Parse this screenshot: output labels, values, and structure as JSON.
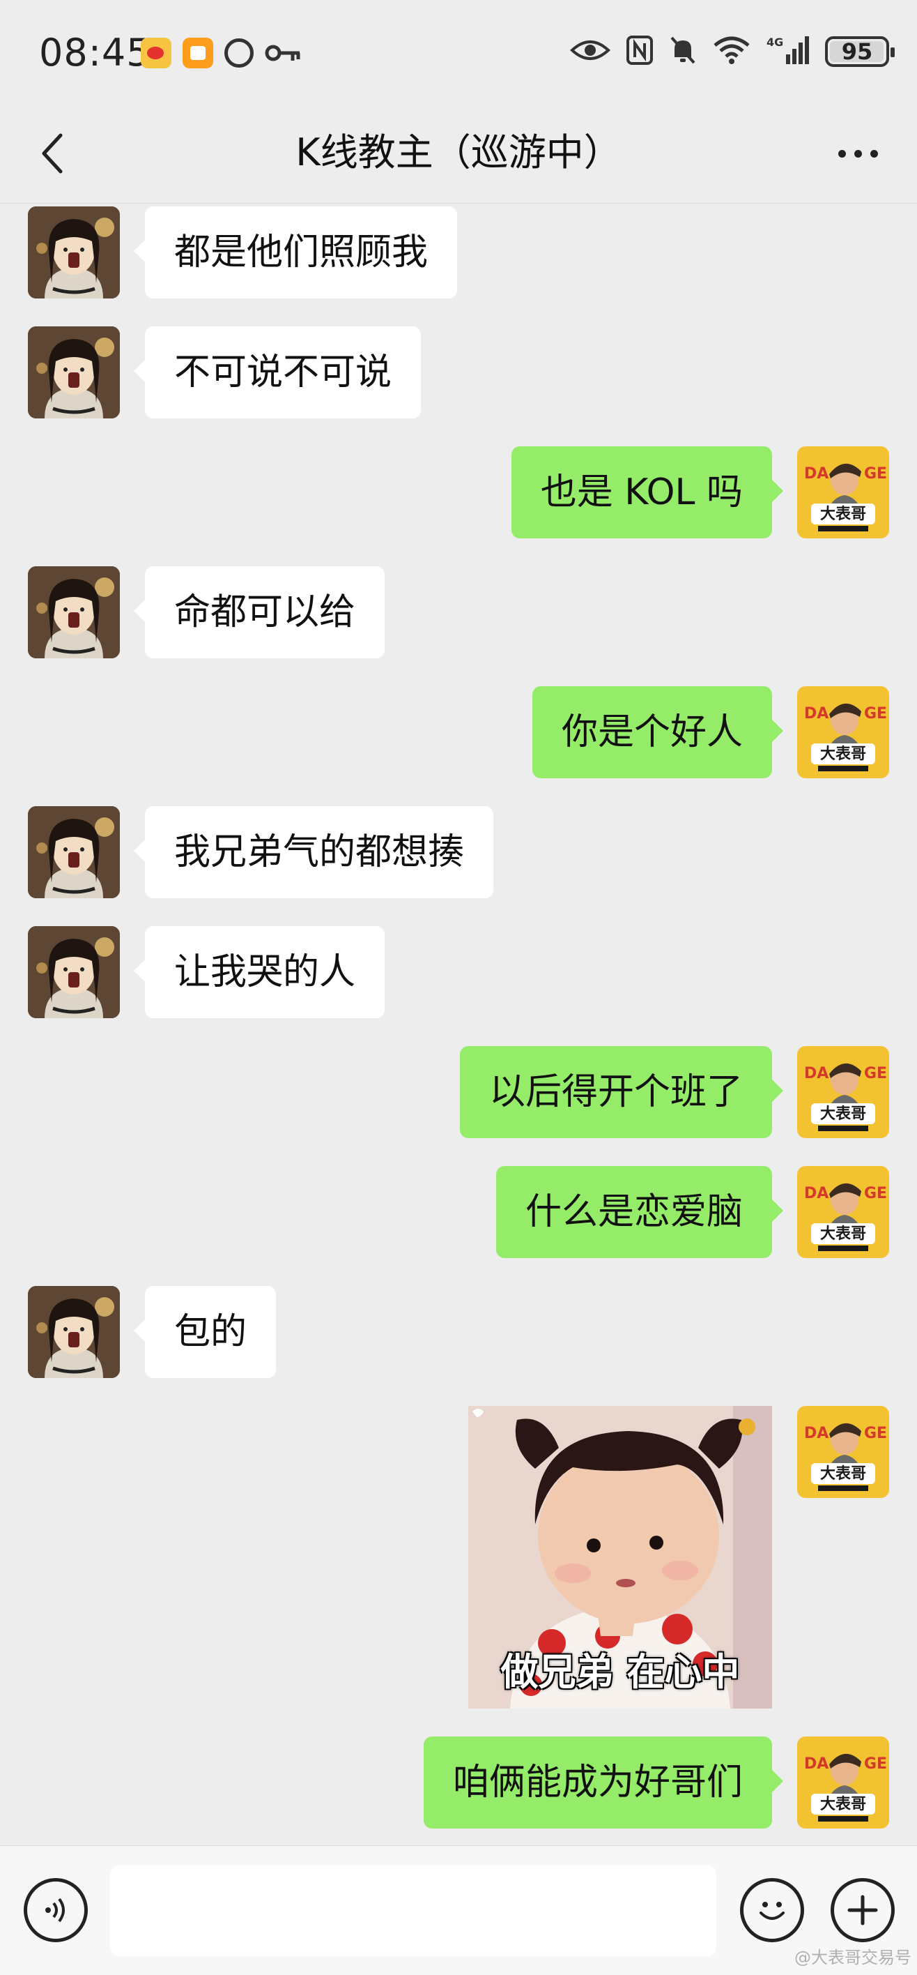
{
  "status_bar": {
    "time": "08:45",
    "battery": "95",
    "network": "4G",
    "icons": [
      "weibo-icon",
      "orange-app-icon",
      "circle-app-icon",
      "key-icon",
      "eye-icon",
      "nfc-icon",
      "mute-icon",
      "wifi-icon",
      "signal-icon",
      "battery-icon"
    ]
  },
  "nav": {
    "title": "K线教主（巡游中）",
    "back_icon": "chevron-left-icon",
    "more_icon": "ellipsis-icon"
  },
  "messages": [
    {
      "side": "left",
      "text": "都是他们照顾我"
    },
    {
      "side": "left",
      "text": "不可说不可说"
    },
    {
      "side": "right",
      "text": "也是 KOL 吗"
    },
    {
      "side": "left",
      "text": "命都可以给"
    },
    {
      "side": "right",
      "text": "你是个好人"
    },
    {
      "side": "left",
      "text": "我兄弟气的都想揍"
    },
    {
      "side": "left",
      "text": "让我哭的人"
    },
    {
      "side": "right",
      "text": "以后得开个班了"
    },
    {
      "side": "right",
      "text": "什么是恋爱脑"
    },
    {
      "side": "left",
      "text": "包的"
    },
    {
      "side": "right",
      "type": "sticker",
      "caption": "做兄弟 在心中"
    },
    {
      "side": "right",
      "text": "咱俩能成为好哥们"
    }
  ],
  "input_bar": {
    "placeholder": "",
    "voice_icon": "voice-icon",
    "emoji_icon": "emoji-icon",
    "plus_icon": "plus-icon"
  },
  "avatar_self": {
    "text_top": "DAGE",
    "text_main": "大表哥"
  },
  "watermark": "@大表哥交易号",
  "colors": {
    "background": "#ededed",
    "bubble_self": "#95ec69",
    "bubble_other": "#ffffff",
    "avatar_self_bg": "#f2c230"
  }
}
